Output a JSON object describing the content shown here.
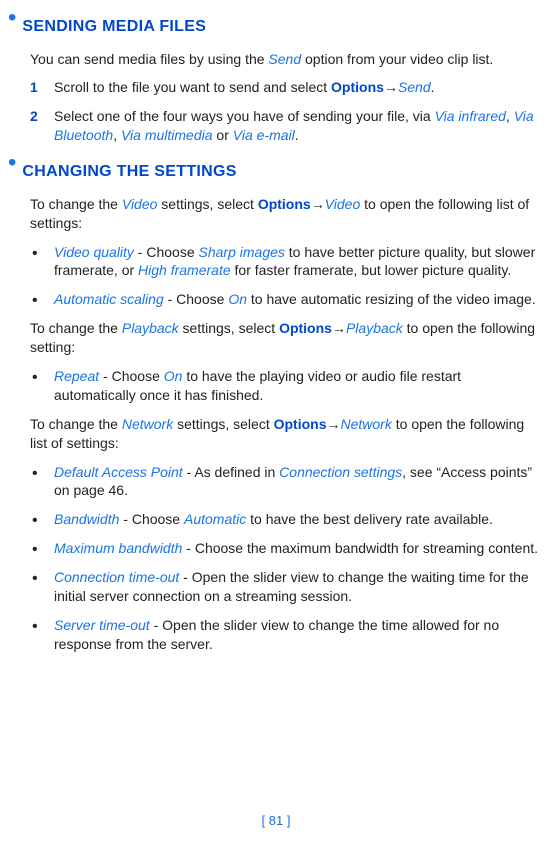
{
  "section1": {
    "title": "SENDING MEDIA FILES",
    "intro_a": "You can send media files by using the ",
    "intro_b": "Send",
    "intro_c": " option from your video clip list.",
    "steps": [
      {
        "num": "1",
        "t1": "Scroll to the file you want to send and select ",
        "opt": "Options",
        "arrow": "→",
        "t2": "Send",
        "t3": "."
      },
      {
        "num": "2",
        "t1": "Select one of the four ways you have of sending your file, via ",
        "v1": "Via infrared",
        "c1": ", ",
        "v2": "Via Bluetooth",
        "c2": ", ",
        "v3": "Via multimedia",
        "c3": " or ",
        "v4": "Via e-mail",
        "c4": "."
      }
    ]
  },
  "section2": {
    "title": "CHANGING THE SETTINGS",
    "p1": {
      "a": "To change the ",
      "b": "Video",
      "c": " settings, select ",
      "opt": "Options",
      "arrow": "→",
      "d": "Video",
      "e": " to open the following list of settings:"
    },
    "list1": [
      {
        "term": "Video quality",
        "a": " - Choose ",
        "b": "Sharp images",
        "c": " to have better picture quality, but slower framerate, or ",
        "d": "High framerate",
        "e": " for faster framerate, but lower picture quality."
      },
      {
        "term": "Automatic scaling",
        "a": " - Choose ",
        "b": "On",
        "c": " to have automatic resizing of the video image."
      }
    ],
    "p2": {
      "a": "To change the ",
      "b": "Playback",
      "c": " settings, select ",
      "opt": "Options",
      "arrow": "→",
      "d": "Playback",
      "e": " to open the following setting:"
    },
    "list2": [
      {
        "term": "Repeat",
        "a": " - Choose ",
        "b": "On",
        "c": " to have the playing video or audio file restart automatically once it has finished."
      }
    ],
    "p3": {
      "a": "To change the ",
      "b": "Network",
      "c": " settings, select ",
      "opt": "Options",
      "arrow": "→",
      "d": "Network",
      "e": " to open the following list of settings:"
    },
    "list3": [
      {
        "term": "Default Access Point",
        "a": " - As defined in ",
        "b": "Connection settings",
        "c": ", see “Access points” on page 46."
      },
      {
        "term": "Bandwidth",
        "a": " - Choose ",
        "b": "Automatic",
        "c": " to have the best delivery rate available."
      },
      {
        "term": "Maximum bandwidth",
        "a": " - Choose the maximum bandwidth for streaming content."
      },
      {
        "term": "Connection time-out",
        "a": " - Open the slider view to change the waiting time for the initial server connection on a streaming session."
      },
      {
        "term": "Server time-out",
        "a": " - Open the slider view to change the time allowed for no response from the server."
      }
    ]
  },
  "page_number": "[ 81 ]"
}
